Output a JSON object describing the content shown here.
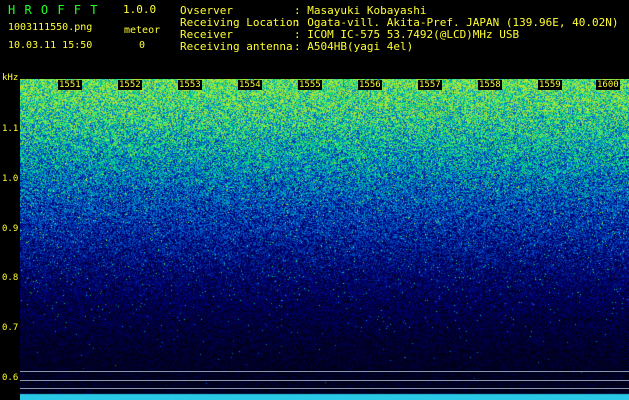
{
  "app": {
    "title": "H R O F F T",
    "version": "1.0.0"
  },
  "file": {
    "name": "1003111550.png",
    "datetime": "10.03.11 15:50"
  },
  "meteor": {
    "label": "meteor",
    "count": "0"
  },
  "info": [
    {
      "key": "Ovserver",
      "value": ": Masayuki Kobayashi"
    },
    {
      "key": "Receiving Location",
      "value": ": Ogata-vill. Akita-Pref. JAPAN (139.96E, 40.02N)"
    },
    {
      "key": "Receiver",
      "value": ": ICOM IC-575 53.7492(@LCD)MHz USB"
    },
    {
      "key": "Receiving antenna",
      "value": ": A504HB(yagi 4el)"
    }
  ],
  "axis": {
    "unit": "kHz",
    "ticks": [
      "1.1",
      "1.0",
      "0.9",
      "0.8",
      "0.7",
      "0.6"
    ]
  },
  "minutes": [
    "1551",
    "1552",
    "1553",
    "1554",
    "1555",
    "1556",
    "1557",
    "1558",
    "1559",
    "1600"
  ]
}
